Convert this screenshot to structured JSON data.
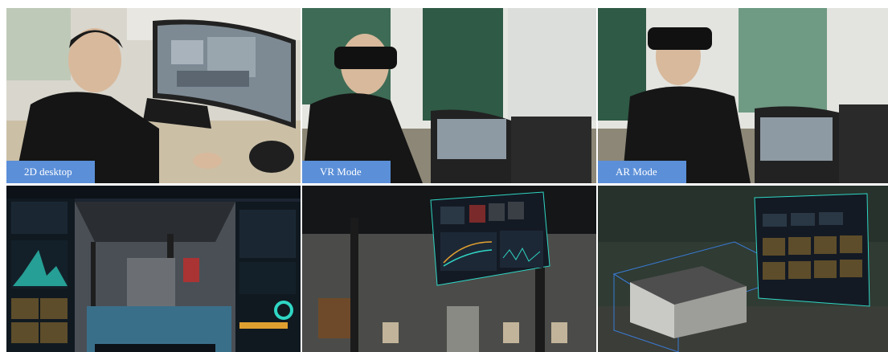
{
  "figure": {
    "labels": {
      "desktop": "2D desktop",
      "vr": "VR Mode",
      "ar": "AR Mode"
    },
    "colors": {
      "label_bg": "#5b8fd8",
      "label_text": "#ffffff",
      "ui_accent": "#2fd6c4",
      "ui_panel": "#141a24"
    }
  }
}
